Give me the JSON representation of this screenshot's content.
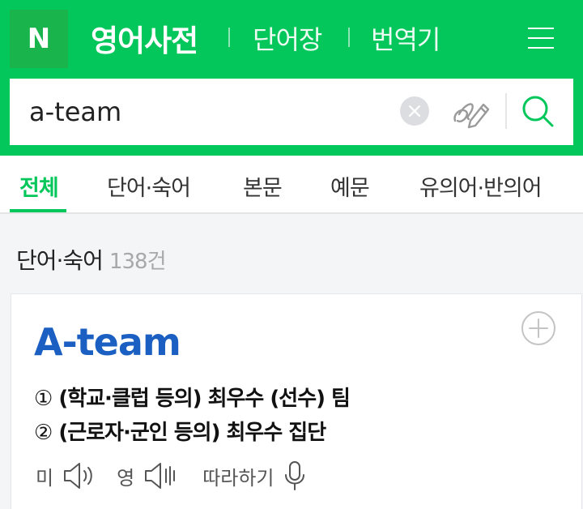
{
  "header": {
    "logo": "N",
    "title": "영어사전",
    "links": [
      "단어장",
      "번역기"
    ]
  },
  "search": {
    "value": "a-team",
    "placeholder": ""
  },
  "tabs": [
    "전체",
    "단어·숙어",
    "본문",
    "예문",
    "유의어·반의어"
  ],
  "active_tab": "전체",
  "section": {
    "title": "단어·숙어",
    "count": "138건"
  },
  "entry": {
    "word": "A-team",
    "meanings": [
      {
        "num": "①",
        "text": "(학교·클럽 등의) 최우수 (선수) 팀"
      },
      {
        "num": "②",
        "text": "(근로자·군인 등의) 최우수 집단"
      }
    ],
    "pron_us": "미",
    "pron_uk": "영",
    "follow": "따라하기"
  },
  "colors": {
    "brand_green": "#03c75a",
    "logo_bg": "#19b54c",
    "entry_blue": "#1a5fc1"
  },
  "icons": [
    "menu-icon",
    "clear-icon",
    "handwriting-pen-icon",
    "search-icon",
    "add-circle-icon",
    "speaker-icon",
    "speaker-slow-icon",
    "microphone-icon"
  ]
}
